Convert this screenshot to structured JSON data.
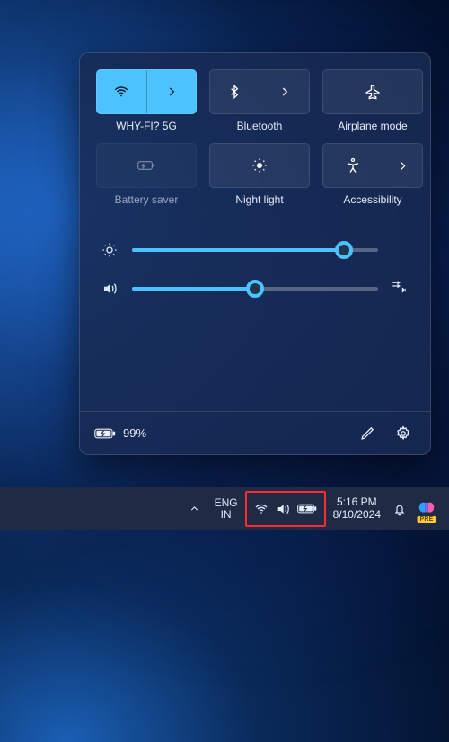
{
  "panel": {
    "tiles": [
      {
        "id": "wifi",
        "label": "WHY-FI? 5G",
        "active": true,
        "split": true,
        "icon": "wifi-icon"
      },
      {
        "id": "bluetooth",
        "label": "Bluetooth",
        "active": false,
        "split": true,
        "icon": "bluetooth-icon"
      },
      {
        "id": "airplane",
        "label": "Airplane mode",
        "active": false,
        "split": false,
        "icon": "airplane-icon"
      },
      {
        "id": "battery-saver",
        "label": "Battery saver",
        "active": false,
        "split": false,
        "icon": "battery-saver-icon",
        "disabled": true
      },
      {
        "id": "night-light",
        "label": "Night light",
        "active": false,
        "split": false,
        "icon": "night-light-icon"
      },
      {
        "id": "accessibility",
        "label": "Accessibility",
        "active": false,
        "split": true,
        "icon": "accessibility-icon"
      }
    ],
    "sliders": {
      "brightness": 86,
      "volume": 50
    },
    "battery": {
      "text": "99%"
    }
  },
  "taskbar": {
    "language": {
      "line1": "ENG",
      "line2": "IN"
    },
    "time": "5:16 PM",
    "date": "8/10/2024",
    "copilot_badge": "PRE"
  },
  "highlight": {
    "target": "system-tray-icons",
    "color": "#ff2a2a"
  }
}
